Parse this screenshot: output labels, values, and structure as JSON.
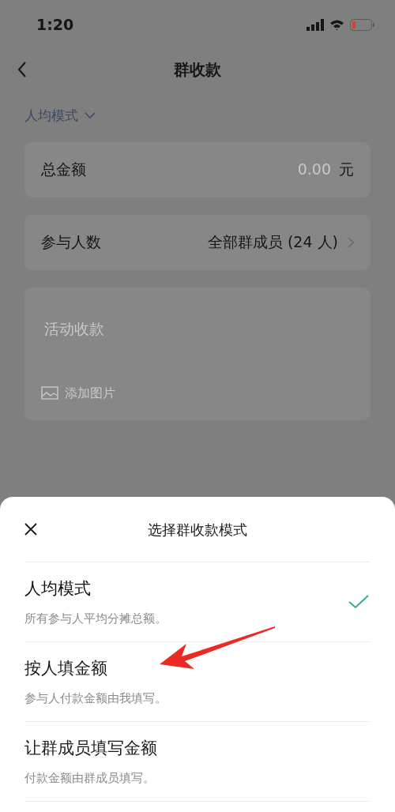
{
  "status_bar": {
    "time": "1:20"
  },
  "nav": {
    "title": "群收款"
  },
  "mode_selector": {
    "label": "人均模式"
  },
  "total": {
    "label": "总金额",
    "placeholder": "0.00",
    "unit": "元"
  },
  "participants": {
    "label": "参与人数",
    "value": "全部群成员 (24 人)"
  },
  "note": {
    "placeholder": "活动收款",
    "add_image": "添加图片"
  },
  "sheet": {
    "title": "选择群收款模式",
    "options": [
      {
        "title": "人均模式",
        "description": "所有参与人平均分摊总额。",
        "selected": true
      },
      {
        "title": "按人填金额",
        "description": "参与人付款金额由我填写。",
        "selected": false
      },
      {
        "title": "让群成员填写金额",
        "description": "付款金额由群成员填写。",
        "selected": false
      }
    ]
  }
}
